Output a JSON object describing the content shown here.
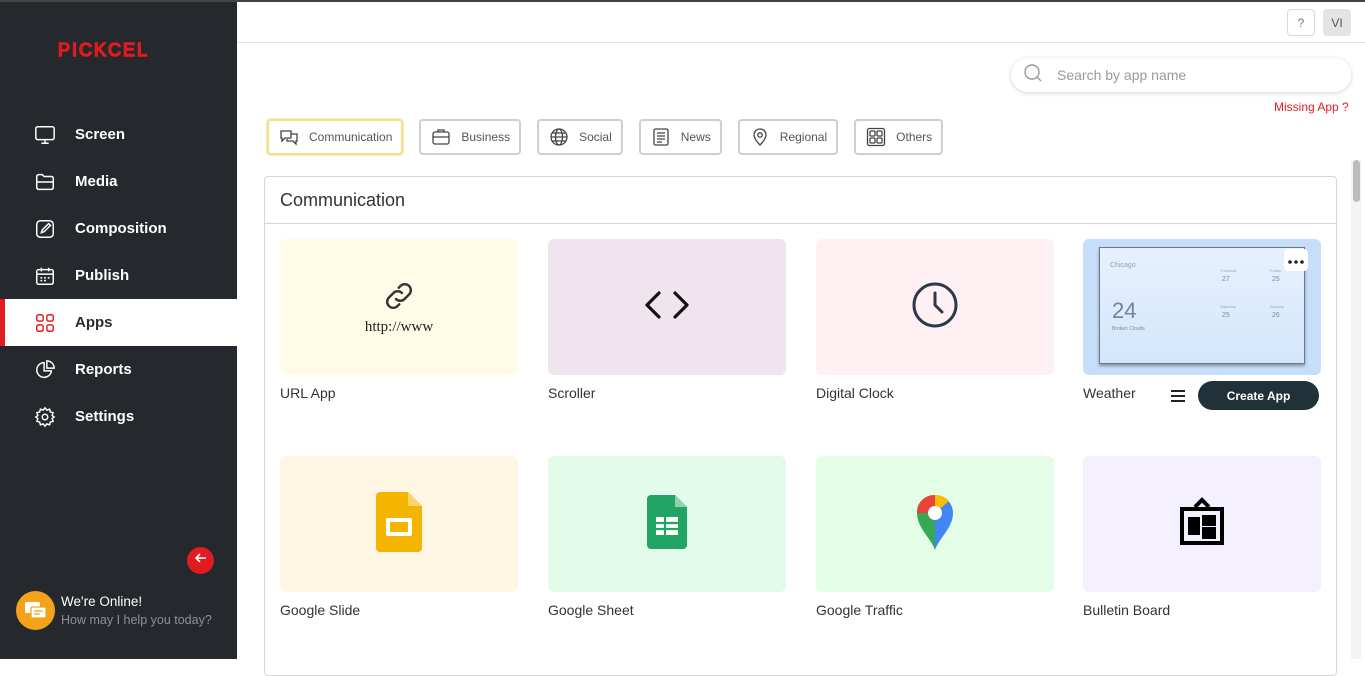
{
  "brand": {
    "logo_text": "PICKCEL",
    "color": "#e21b22"
  },
  "sidebar": {
    "items": [
      {
        "label": "Screen",
        "icon": "monitor-icon"
      },
      {
        "label": "Media",
        "icon": "folder-icon"
      },
      {
        "label": "Composition",
        "icon": "edit-icon"
      },
      {
        "label": "Publish",
        "icon": "calendar-icon"
      },
      {
        "label": "Apps",
        "icon": "apps-grid-icon",
        "active": true
      },
      {
        "label": "Reports",
        "icon": "pie-chart-icon"
      },
      {
        "label": "Settings",
        "icon": "gear-icon"
      }
    ],
    "collapse_icon": "arrow-left-icon"
  },
  "chat": {
    "title": "We're Online!",
    "subtitle": "How may I help you today?"
  },
  "header": {
    "help_label": "?",
    "user_initials": "VI"
  },
  "search": {
    "placeholder": "Search by app name",
    "value": ""
  },
  "missing_app_label": "Missing App ?",
  "tabs": [
    {
      "label": "Communication",
      "icon": "chat-icon",
      "active": true
    },
    {
      "label": "Business",
      "icon": "briefcase-icon"
    },
    {
      "label": "Social",
      "icon": "globe-icon"
    },
    {
      "label": "News",
      "icon": "newspaper-icon"
    },
    {
      "label": "Regional",
      "icon": "location-pin-icon"
    },
    {
      "label": "Others",
      "icon": "grid-icon"
    }
  ],
  "panel": {
    "title": "Communication"
  },
  "apps": [
    {
      "name": "URL App",
      "thumb_text": "http://www",
      "icon": "link-icon",
      "bg": "#fffbe6"
    },
    {
      "name": "Scroller",
      "icon": "code-icon",
      "bg": "#f0e4ee"
    },
    {
      "name": "Digital Clock",
      "icon": "clock-icon",
      "bg": "#fff0f4"
    },
    {
      "name": "Weather",
      "icon": "weather-preview",
      "bg": "#c7defa"
    },
    {
      "name": "Google Slide",
      "icon": "google-slides-icon",
      "bg": "#fff6e3"
    },
    {
      "name": "Google Sheet",
      "icon": "google-sheets-icon",
      "bg": "#e3fbeb"
    },
    {
      "name": "Google Traffic",
      "icon": "google-maps-icon",
      "bg": "#e3fde6"
    },
    {
      "name": "Bulletin Board",
      "icon": "bulletin-board-icon",
      "bg": "#f4f0fe"
    }
  ],
  "weather_preview": {
    "city": "Chicago",
    "temp": "24",
    "desc": "Broken Clouds",
    "forecast": [
      {
        "day": "Thursday",
        "value": "27"
      },
      {
        "day": "Friday",
        "value": "25"
      },
      {
        "day": "Saturday",
        "value": "25"
      },
      {
        "day": "Sunday",
        "value": "26"
      }
    ]
  },
  "create_app_label": "Create App"
}
